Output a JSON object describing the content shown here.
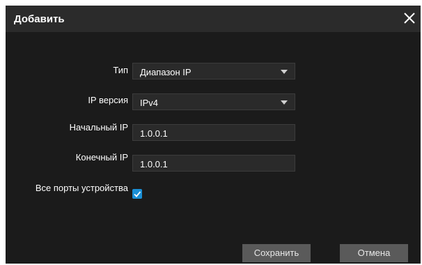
{
  "dialog": {
    "title": "Добавить",
    "close_icon": "close-icon"
  },
  "form": {
    "type_label": "Тип",
    "type_value": "Диапазон IP",
    "ip_version_label": "IP версия",
    "ip_version_value": "IPv4",
    "start_ip_label": "Начальный IP",
    "start_ip_value": "1.0.0.1",
    "end_ip_label": "Конечный IP",
    "end_ip_value": "1.0.0.1",
    "all_ports_label": "Все порты устройства",
    "all_ports_checked": true
  },
  "buttons": {
    "save_label": "Сохранить",
    "cancel_label": "Отмена"
  },
  "colors": {
    "background": "#1b1b1b",
    "accent": "#1a8fd6",
    "button": "#5a5a5a"
  }
}
